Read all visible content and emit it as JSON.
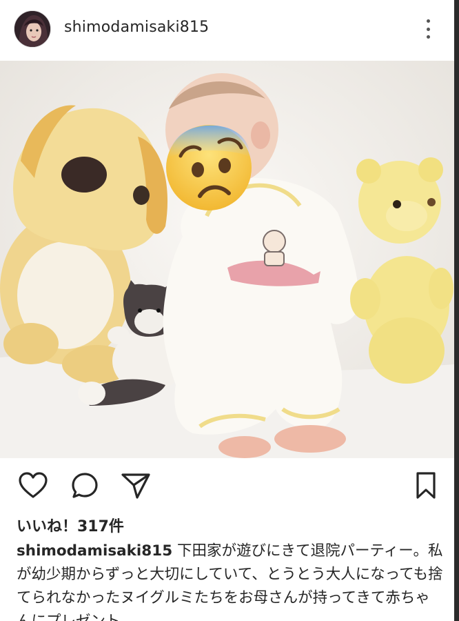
{
  "post": {
    "username": "shimodamisaki815",
    "likes_text": "いいね！317件",
    "caption_user": "shimodamisaki815",
    "caption_text": "下田家が遊びにきて退院パーティー。私が幼少期からずっと大切にしていて、とうとう大人になっても捨てられなかったヌイグルミたちをお母さんが持ってきて赤ちゃんにプレゼント。"
  },
  "icons": {
    "more": "more-options-icon",
    "like": "heart-icon",
    "comment": "comment-icon",
    "share": "send-icon",
    "save": "bookmark-icon",
    "face_cover": "anxious-face-emoji"
  },
  "colors": {
    "text": "#262626",
    "background": "#ffffff",
    "emoji_yellow": "#f7c33c",
    "emoji_blue": "#7fb3e8"
  }
}
